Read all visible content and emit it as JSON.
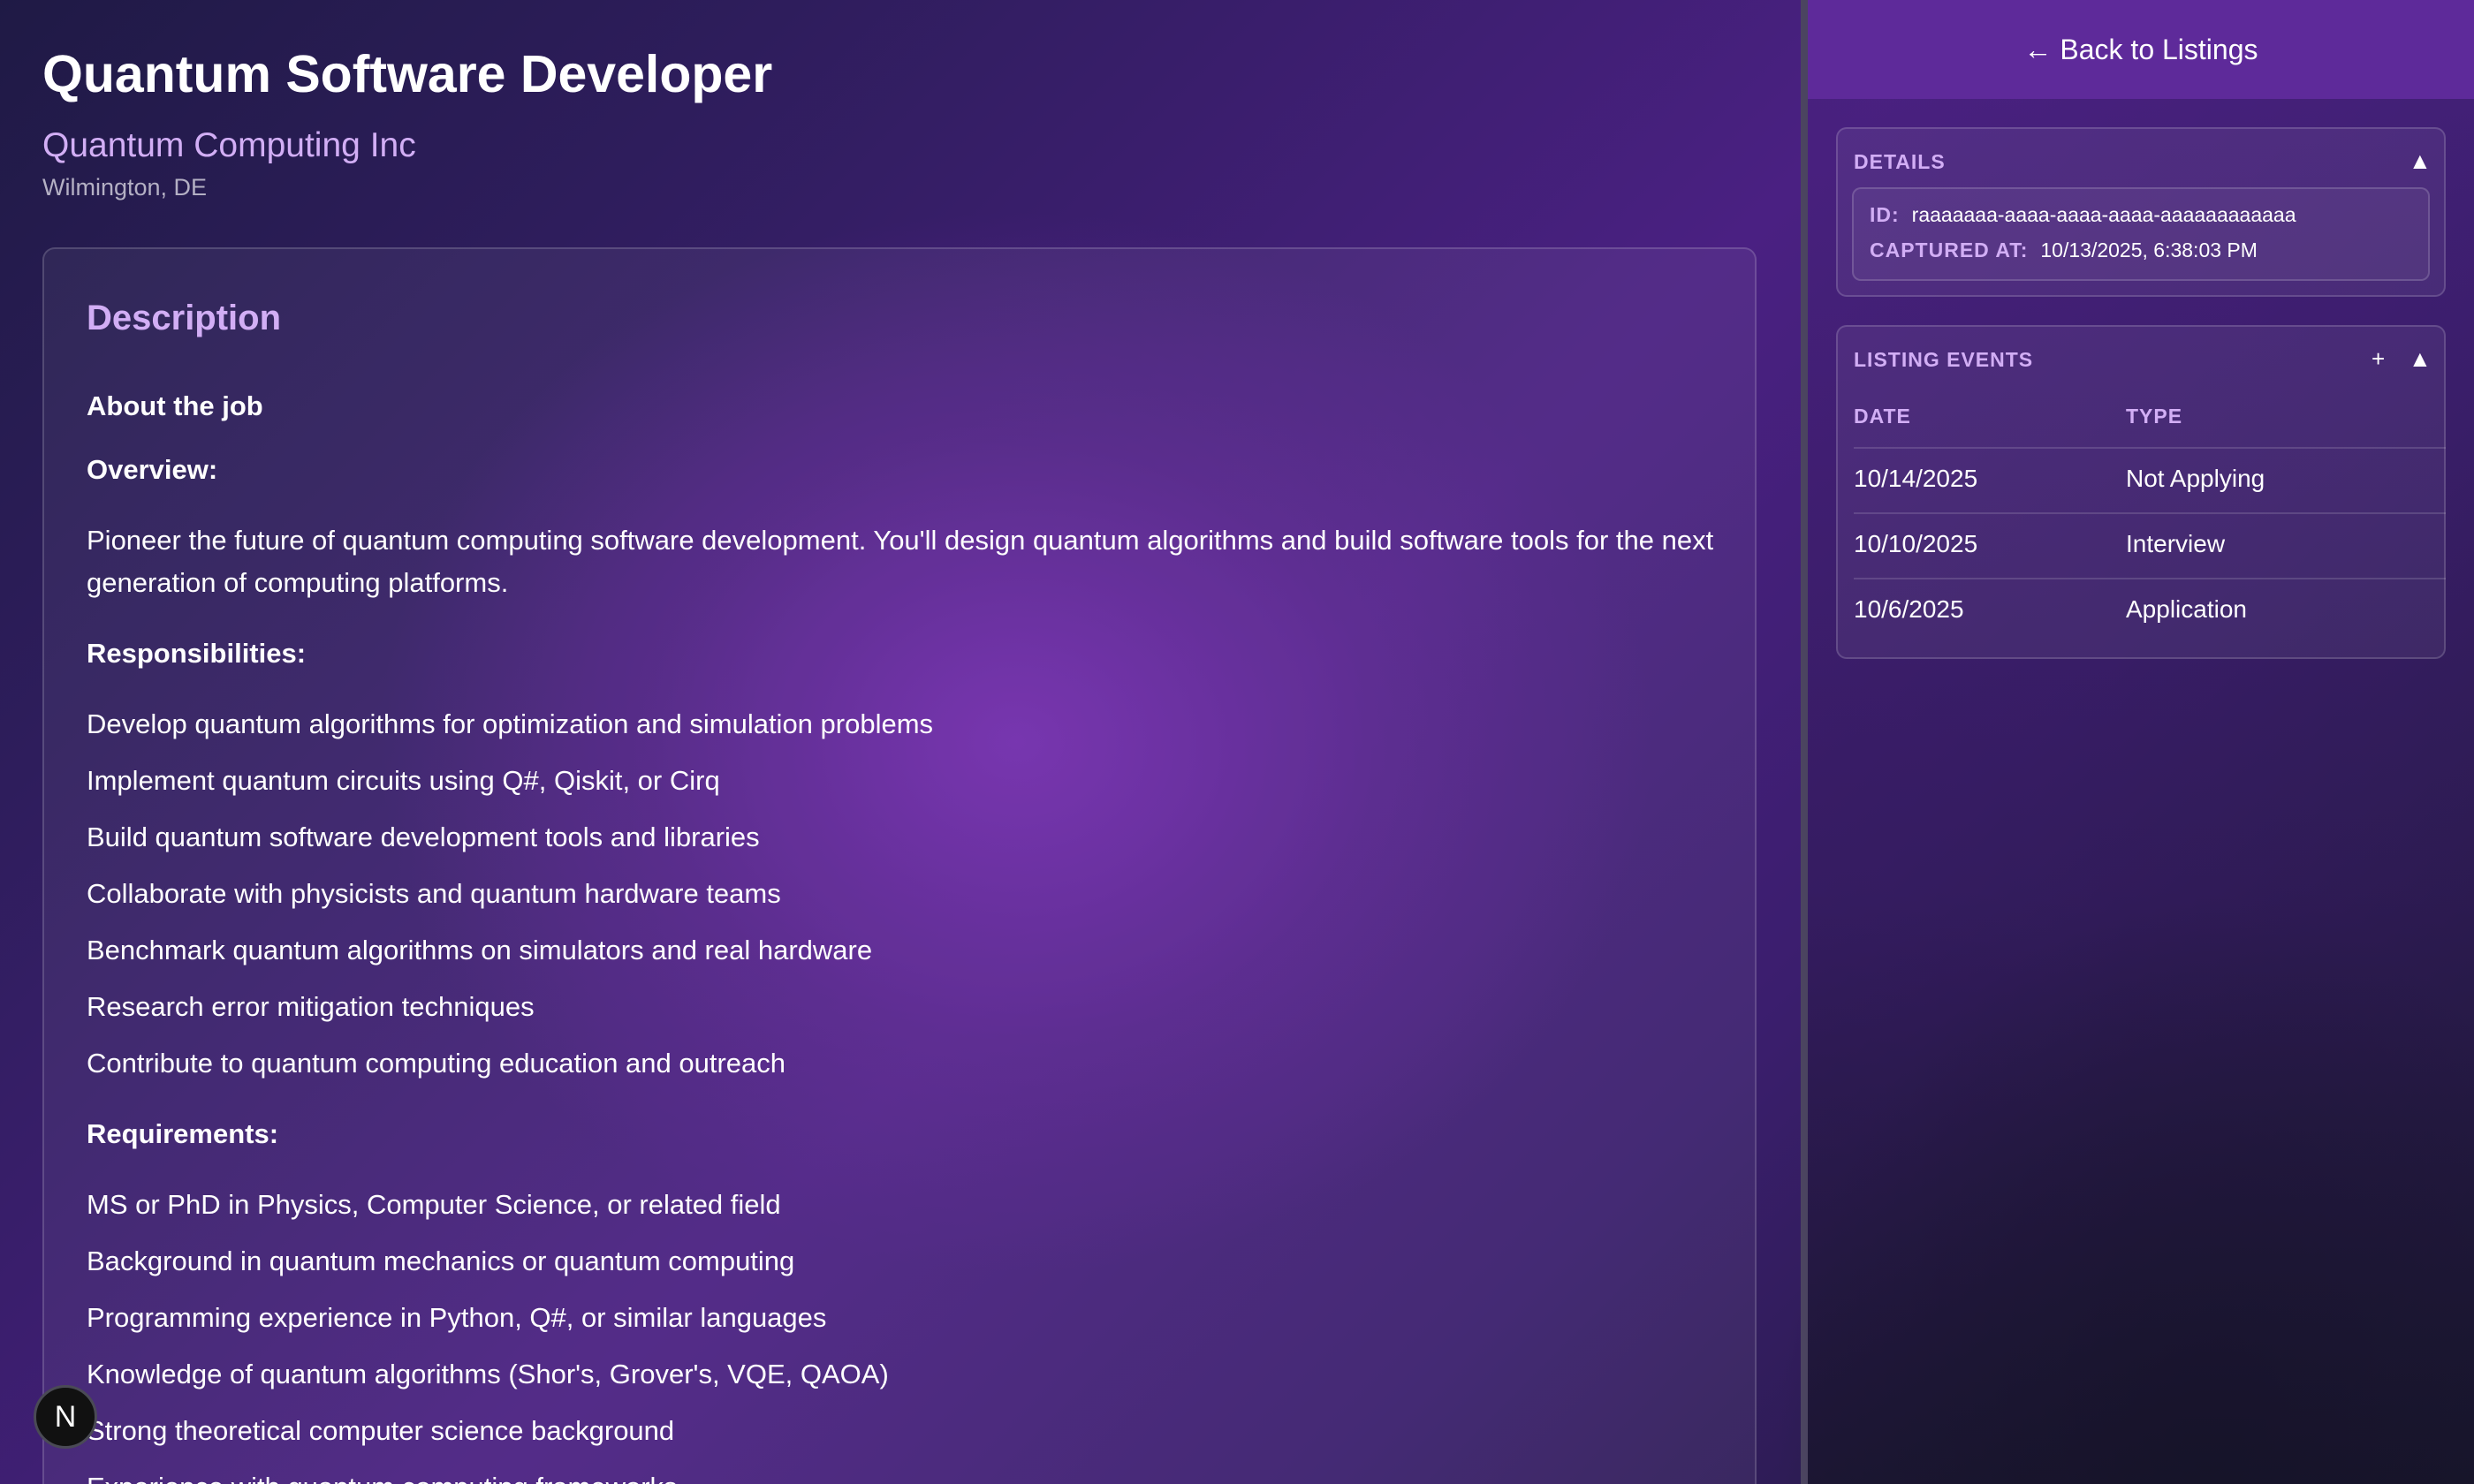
{
  "job": {
    "title": "Quantum Software Developer",
    "company": "Quantum Computing Inc",
    "location": "Wilmington, DE"
  },
  "description": {
    "heading": "Description",
    "about": "About the job",
    "overview_label": "Overview:",
    "overview_text": "Pioneer the future of quantum computing software development. You'll design quantum algorithms and build software tools for the next generation of computing platforms.",
    "responsibilities_label": "Responsibilities:",
    "responsibilities": [
      "Develop quantum algorithms for optimization and simulation problems",
      "Implement quantum circuits using Q#, Qiskit, or Cirq",
      "Build quantum software development tools and libraries",
      "Collaborate with physicists and quantum hardware teams",
      "Benchmark quantum algorithms on simulators and real hardware",
      "Research error mitigation techniques",
      "Contribute to quantum computing education and outreach"
    ],
    "requirements_label": "Requirements:",
    "requirements": [
      "MS or PhD in Physics, Computer Science, or related field",
      "Background in quantum mechanics or quantum computing",
      "Programming experience in Python, Q#, or similar languages",
      "Knowledge of quantum algorithms (Shor's, Grover's, VQE, QAOA)",
      "Strong theoretical computer science background",
      "Experience with quantum computing frameworks"
    ]
  },
  "sidebar": {
    "back_label": "← Back to Listings",
    "details": {
      "title": "DETAILS",
      "collapse_icon": "▲",
      "id_label": "ID:",
      "id_value": "raaaaaaa-aaaa-aaaa-aaaa-aaaaaaaaaaaa",
      "captured_label": "CAPTURED AT:",
      "captured_value": "10/13/2025, 6:38:03 PM"
    },
    "events": {
      "title": "LISTING EVENTS",
      "add_icon": "+",
      "collapse_icon": "▲",
      "columns": [
        "DATE",
        "TYPE"
      ],
      "rows": [
        {
          "date": "10/14/2025",
          "type": "Not Applying"
        },
        {
          "date": "10/10/2025",
          "type": "Interview"
        },
        {
          "date": "10/6/2025",
          "type": "Application"
        }
      ]
    }
  },
  "badge": {
    "letter": "N"
  },
  "colors": {
    "accent": "#d2aef5",
    "back_button": "#5e2a9a",
    "text": "#ffffff",
    "muted": "#b4b0c4"
  }
}
